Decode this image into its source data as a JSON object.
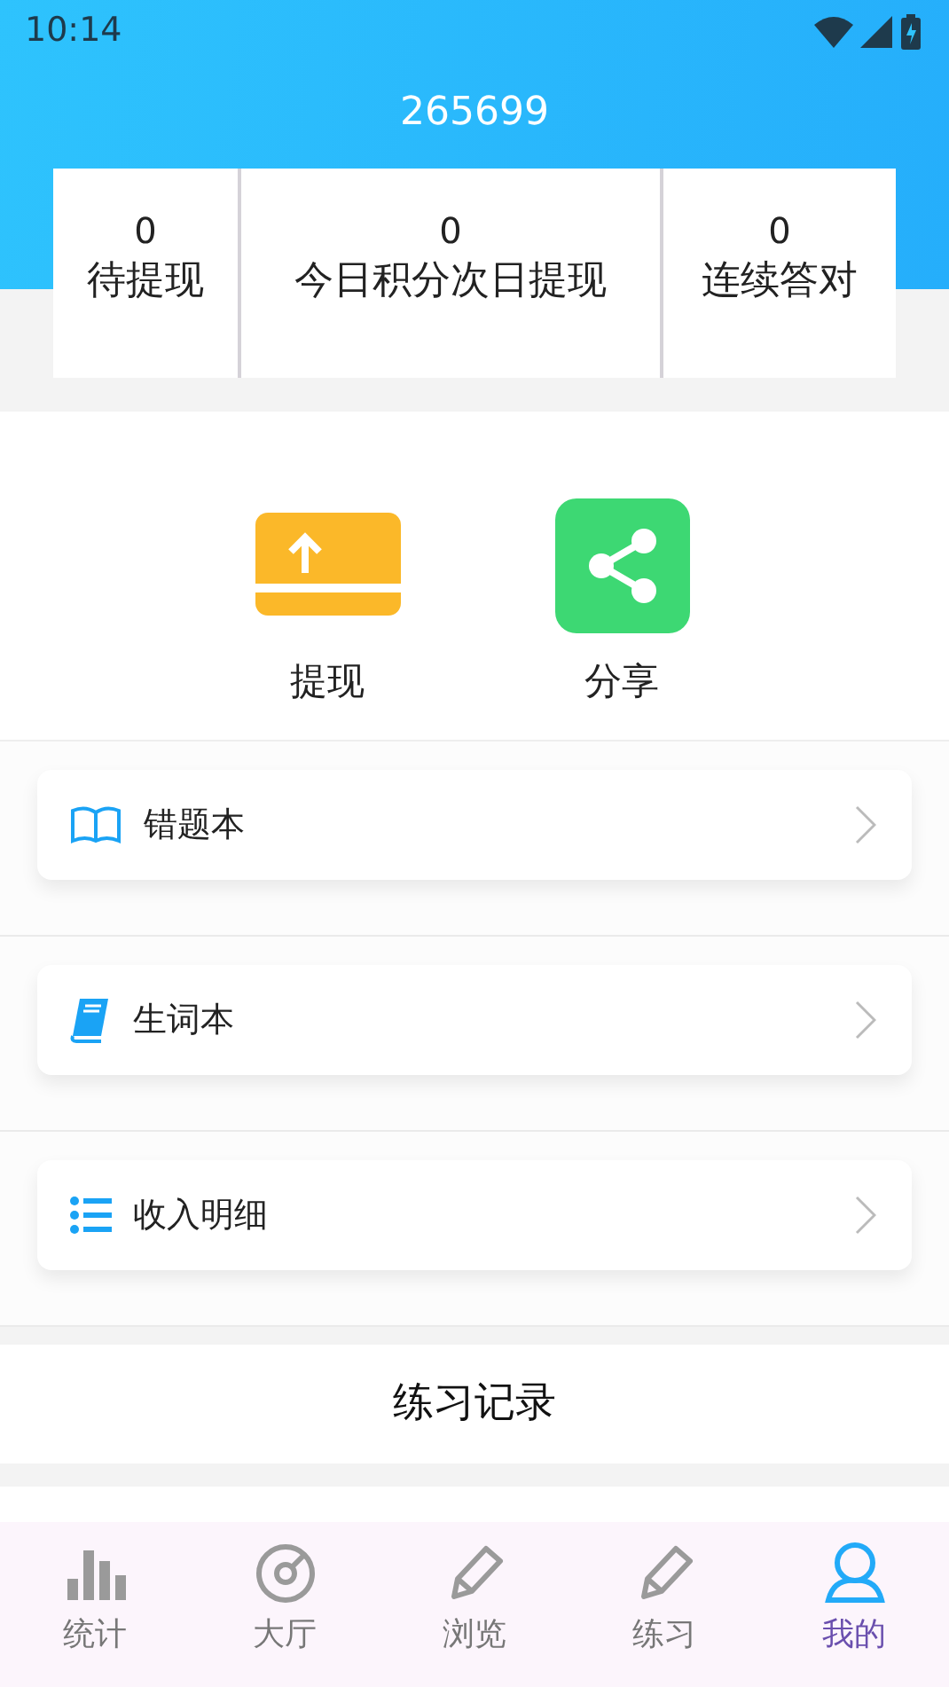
{
  "status_bar": {
    "time": "10:14"
  },
  "header": {
    "title": "265699"
  },
  "stats": [
    {
      "value": "0",
      "label": "待提现"
    },
    {
      "value": "0",
      "label": "今日积分次日提现"
    },
    {
      "value": "0",
      "label": "连续答对"
    }
  ],
  "actions": [
    {
      "label": "提现"
    },
    {
      "label": "分享"
    }
  ],
  "menu": [
    {
      "label": "错题本"
    },
    {
      "label": "生词本"
    },
    {
      "label": "收入明细"
    }
  ],
  "record_button": {
    "label": "练习记录"
  },
  "bottom_nav": [
    {
      "label": "统计",
      "selected": false
    },
    {
      "label": "大厅",
      "selected": false
    },
    {
      "label": "浏览",
      "selected": false
    },
    {
      "label": "练习",
      "selected": false
    },
    {
      "label": "我的",
      "selected": true
    }
  ]
}
